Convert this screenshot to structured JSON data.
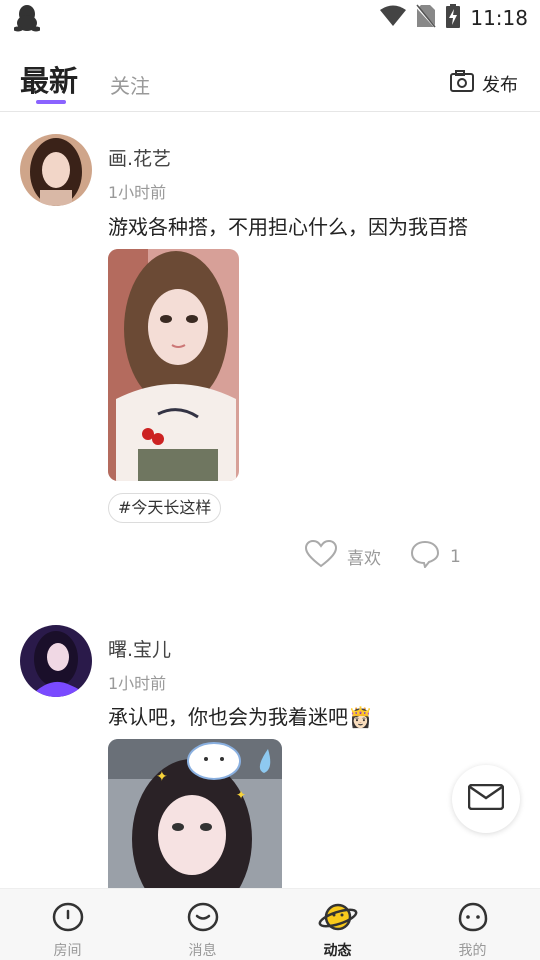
{
  "status_bar": {
    "time": "11:18"
  },
  "header": {
    "tab_latest": "最新",
    "tab_follow": "关注",
    "publish_label": "发布"
  },
  "posts": [
    {
      "username": "画.花艺",
      "time": "1小时前",
      "content": "游戏各种搭，不用担心什么，因为我百搭",
      "tag": "#今天长这样",
      "like_label": "喜欢",
      "comment_count": "1"
    },
    {
      "username": "曙.宝儿",
      "time": "1小时前",
      "content": "承认吧，你也会为我着迷吧👸🏻"
    }
  ],
  "bottom_nav": {
    "items": [
      {
        "label": "房间",
        "icon": "room-face-icon"
      },
      {
        "label": "消息",
        "icon": "message-face-icon"
      },
      {
        "label": "动态",
        "icon": "planet-icon"
      },
      {
        "label": "我的",
        "icon": "profile-face-icon"
      }
    ],
    "active": "动态"
  },
  "colors": {
    "accent": "#8a63ff",
    "planet": "#f8c91c"
  }
}
